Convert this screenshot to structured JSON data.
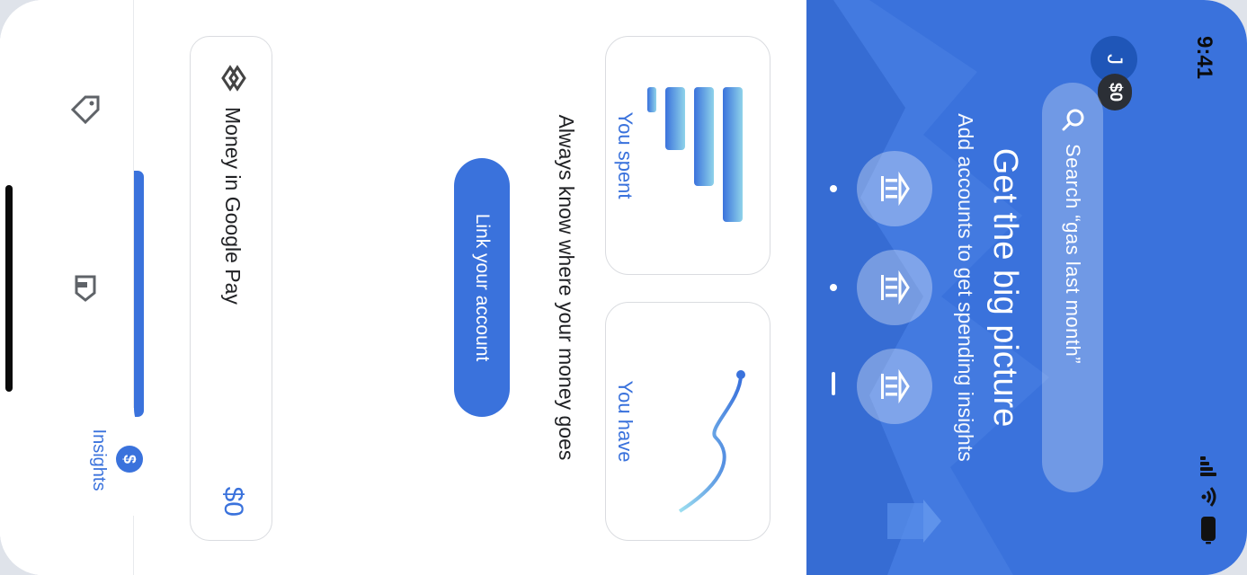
{
  "status_bar": {
    "time": "9:41"
  },
  "header": {
    "avatar_initial": "J",
    "balance_chip": "$0",
    "search_placeholder": "Search “gas last month”",
    "title": "Get the big picture",
    "subtitle": "Add accounts to get spending insights",
    "carousel_icons": [
      "bank-icon",
      "bank-icon",
      "bank-icon"
    ]
  },
  "cards": {
    "spent_label": "You spent",
    "have_label": "You have"
  },
  "tagline": "Always know where your money goes",
  "link_button": "Link your account",
  "money_row": {
    "label": "Money in Google Pay",
    "amount": "$0"
  },
  "bottom_nav": {
    "active_label": "Insights",
    "badge": "$",
    "icons": [
      "tag-icon",
      "label-icon",
      "insights-icon"
    ]
  },
  "colors": {
    "accent": "#3a72dc",
    "header_bg": "#3a72dc"
  }
}
